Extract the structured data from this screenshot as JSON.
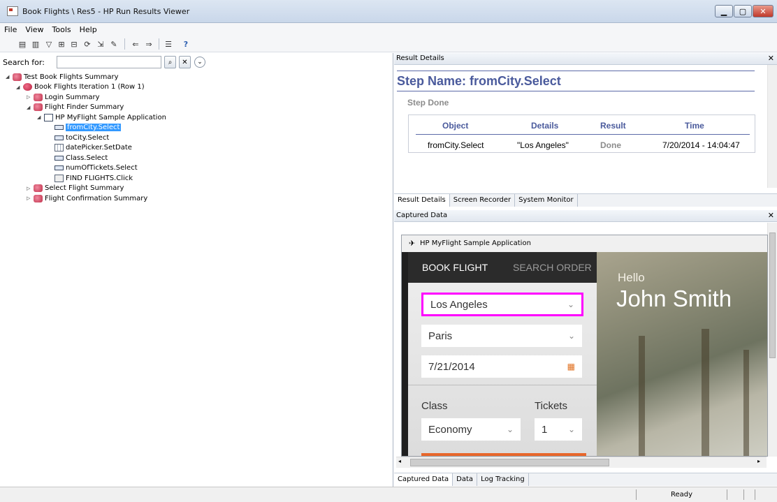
{
  "window": {
    "title": "Book Flights \\ Res5 - HP Run Results Viewer"
  },
  "menu": [
    "File",
    "View",
    "Tools",
    "Help"
  ],
  "search": {
    "label": "Search for:",
    "value": ""
  },
  "tree": [
    {
      "label": "Test Book Flights Summary",
      "level": 0,
      "icon": "summary-icon",
      "expanded": true
    },
    {
      "label": "Book Flights Iteration 1 (Row 1)",
      "level": 1,
      "icon": "iteration-icon",
      "expanded": true
    },
    {
      "label": "Login Summary",
      "level": 2,
      "icon": "summary-icon",
      "expanded": false
    },
    {
      "label": "Flight Finder Summary",
      "level": 2,
      "icon": "summary-icon",
      "expanded": true
    },
    {
      "label": "HP MyFlight Sample Application",
      "level": 3,
      "icon": "window-icon",
      "expanded": true
    },
    {
      "label": "fromCity.Select",
      "level": 4,
      "icon": "combobox-icon",
      "selected": true
    },
    {
      "label": "toCity.Select",
      "level": 4,
      "icon": "combobox-icon"
    },
    {
      "label": "datePicker.SetDate",
      "level": 4,
      "icon": "calendar-icon"
    },
    {
      "label": "Class.Select",
      "level": 4,
      "icon": "combobox-icon"
    },
    {
      "label": "numOfTickets.Select",
      "level": 4,
      "icon": "combobox-icon"
    },
    {
      "label": "FIND FLIGHTS.Click",
      "level": 4,
      "icon": "button-icon"
    },
    {
      "label": "Select Flight Summary",
      "level": 2,
      "icon": "summary-icon",
      "expanded": false
    },
    {
      "label": "Flight Confirmation Summary",
      "level": 2,
      "icon": "summary-icon",
      "expanded": false
    }
  ],
  "result_details": {
    "header": "Result Details",
    "step_name": "Step Name: fromCity.Select",
    "step_status": "Step Done",
    "columns": [
      "Object",
      "Details",
      "Result",
      "Time"
    ],
    "row": [
      "fromCity.Select",
      "\"Los Angeles\"",
      "Done",
      "7/20/2014 - 14:04:47"
    ]
  },
  "top_tabs": [
    "Result Details",
    "Screen Recorder",
    "System Monitor"
  ],
  "captured": {
    "header": "Captured Data",
    "app_title": "HP MyFlight Sample Application",
    "nav": [
      "BOOK FLIGHT",
      "SEARCH ORDER"
    ],
    "from_city": "Los Angeles",
    "to_city": "Paris",
    "date": "7/21/2014",
    "class_label": "Class",
    "class_value": "Economy",
    "tickets_label": "Tickets",
    "tickets_value": "1",
    "greeting": "Hello",
    "user": "John Smith"
  },
  "bottom_tabs": [
    "Captured Data",
    "Data",
    "Log Tracking"
  ],
  "status": "Ready",
  "colors": {
    "highlight": "#ff00ff",
    "step_title": "#4a5a9c",
    "selection": "#3399ff"
  }
}
